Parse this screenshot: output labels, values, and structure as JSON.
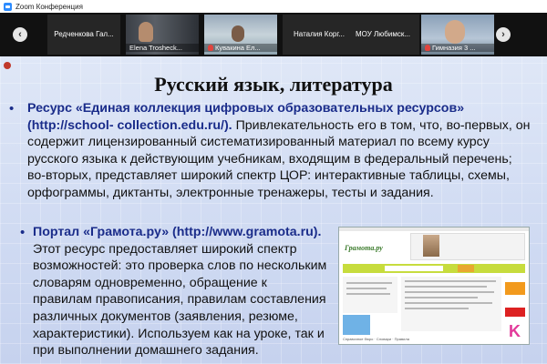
{
  "app": {
    "window_title": "Zoom Конференция"
  },
  "nav": {
    "prev_arrow": "‹",
    "next_arrow": "›"
  },
  "participants": [
    {
      "name": "Редченкова Гал...",
      "has_video": false,
      "muted": false
    },
    {
      "name": "Elena Trosheck...",
      "has_video": true,
      "muted": false
    },
    {
      "name": "Кувакина Ел...",
      "has_video": true,
      "muted": true
    },
    {
      "name": "Наталия Корг...",
      "has_video": false,
      "muted": false
    },
    {
      "name": "МОУ Любимск...",
      "has_video": false,
      "muted": false
    },
    {
      "name": "Гимназия 3 ...",
      "has_video": true,
      "muted": true
    }
  ],
  "slide": {
    "title": "Русский язык, литература",
    "bullet_symbol": "•",
    "item1": {
      "lead": "Ресурс «Единая коллекция цифровых образовательных ресурсов» (http://school- collection.edu.ru/).",
      "body": " Привлекательность его в том, что, во-первых, он содержит лицензированный систематизированный материал по всему курсу русского языка к действующим учебникам, входящим в федеральный перечень; во-вторых, представляет широкий спектр ЦОР: интерактивные таблицы, схемы, орфограммы, диктанты, электронные тренажеры, тесты и задания."
    },
    "item2": {
      "lead": "Портал «Грамота.ру» (http://www.gramota.ru).",
      "body": " Этот  ресурс предоставляет широкий спектр возможностей: это проверка слов по нескольким словарям одновременно, обращение к правилам правописания, правилам составления различных документов (заявления, резюме, характеристики). Используем как на уроке, так и при выполнении домашнего задания."
    },
    "embedded_site": {
      "logo_text": "Грамота.ру",
      "footer_text": "Справочное бюро · Словари · Правила"
    }
  },
  "colors": {
    "accent": "#1a2c8a",
    "zoom_blue": "#2d8cff",
    "slide_bg": "#d6e0f5"
  }
}
